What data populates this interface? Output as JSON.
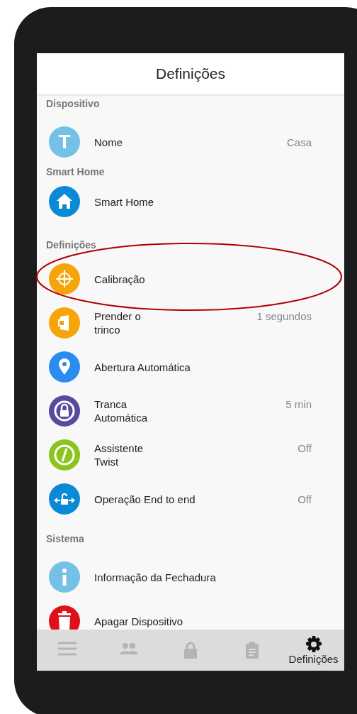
{
  "header": {
    "title": "Definições"
  },
  "sections": [
    {
      "title": "Dispositivo",
      "items": [
        {
          "kind": "letter",
          "icon_text": "T",
          "label": "Nome",
          "value": "Casa"
        }
      ]
    },
    {
      "title": "Smart Home",
      "items": [
        {
          "kind": "home",
          "label": "Smart Home"
        }
      ]
    },
    {
      "title": "Definições",
      "items": [
        {
          "kind": "target",
          "label": "Calibração",
          "highlighted": true
        },
        {
          "kind": "door",
          "label": "Prender o\ntrinco",
          "value": "1 segundos"
        },
        {
          "kind": "pin",
          "label": "Abertura Automática"
        },
        {
          "kind": "autolock",
          "label": "Tranca\nAutomática",
          "value": "5 min"
        },
        {
          "kind": "twist",
          "label": "Assistente\nTwist",
          "value": "Off"
        },
        {
          "kind": "endtoend",
          "label": "Operação End to end",
          "value": "Off"
        }
      ]
    },
    {
      "title": "Sistema",
      "items": [
        {
          "kind": "info",
          "label": "Informação da Fechadura"
        },
        {
          "kind": "trash",
          "label": "Apagar Dispositivo"
        }
      ]
    }
  ],
  "nav": [
    {
      "kind": "menu",
      "selected": false
    },
    {
      "kind": "people",
      "selected": false
    },
    {
      "kind": "lock",
      "selected": false
    },
    {
      "kind": "clipboard",
      "selected": false
    },
    {
      "kind": "gear",
      "label": "Definições",
      "selected": true
    }
  ]
}
